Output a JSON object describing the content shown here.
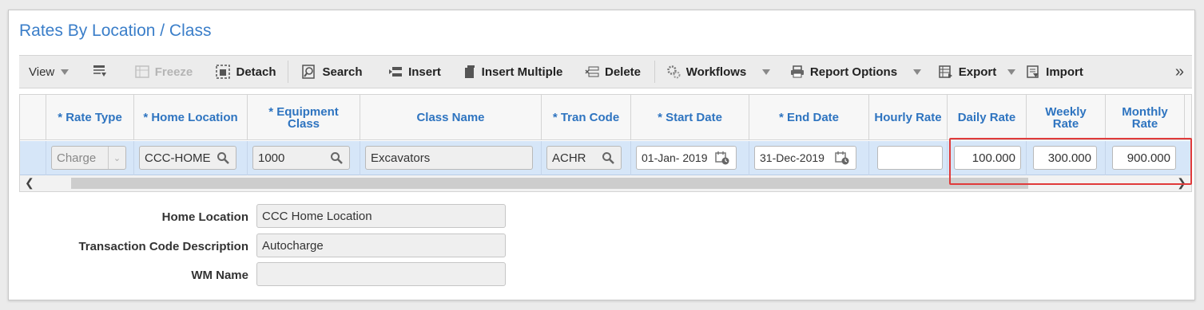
{
  "page": {
    "title": "Rates By Location / Class"
  },
  "toolbar": {
    "view_label": "View",
    "freeze_label": "Freeze",
    "detach_label": "Detach",
    "search_label": "Search",
    "insert_label": "Insert",
    "insert_multiple_label": "Insert Multiple",
    "delete_label": "Delete",
    "workflows_label": "Workflows",
    "report_options_label": "Report Options",
    "export_label": "Export",
    "import_label": "Import",
    "more_label": "»"
  },
  "grid": {
    "headers": {
      "rate_type": "* Rate Type",
      "home_location": "* Home Location",
      "equipment_class_1": "* Equipment",
      "equipment_class_2": "Class",
      "class_name": "Class Name",
      "tran_code": "* Tran Code",
      "start_date": "* Start Date",
      "end_date": "* End Date",
      "hourly_rate": "Hourly Rate",
      "daily_rate": "Daily Rate",
      "weekly_rate_1": "Weekly",
      "weekly_rate_2": "Rate",
      "monthly_rate_1": "Monthly",
      "monthly_rate_2": "Rate"
    },
    "row": {
      "rate_type": "Charge",
      "home_location": "CCC-HOME",
      "equipment_class": "1000",
      "class_name": "Excavators",
      "tran_code": "ACHR",
      "start_date": "01-Jan- 2019",
      "end_date": "31-Dec-2019",
      "hourly_rate": "",
      "daily_rate": "100.000",
      "weekly_rate": "300.000",
      "monthly_rate": "900.000"
    }
  },
  "details": {
    "home_location_label": "Home Location",
    "home_location_value": "CCC Home Location",
    "tran_desc_label": "Transaction Code Description",
    "tran_desc_value": "Autocharge",
    "wm_name_label": "WM Name",
    "wm_name_value": ""
  },
  "colors": {
    "accent": "#3a7ec9",
    "header_text": "#2e74c0",
    "highlight": "#e03a3a",
    "row_selected": "#d6e6f8"
  }
}
